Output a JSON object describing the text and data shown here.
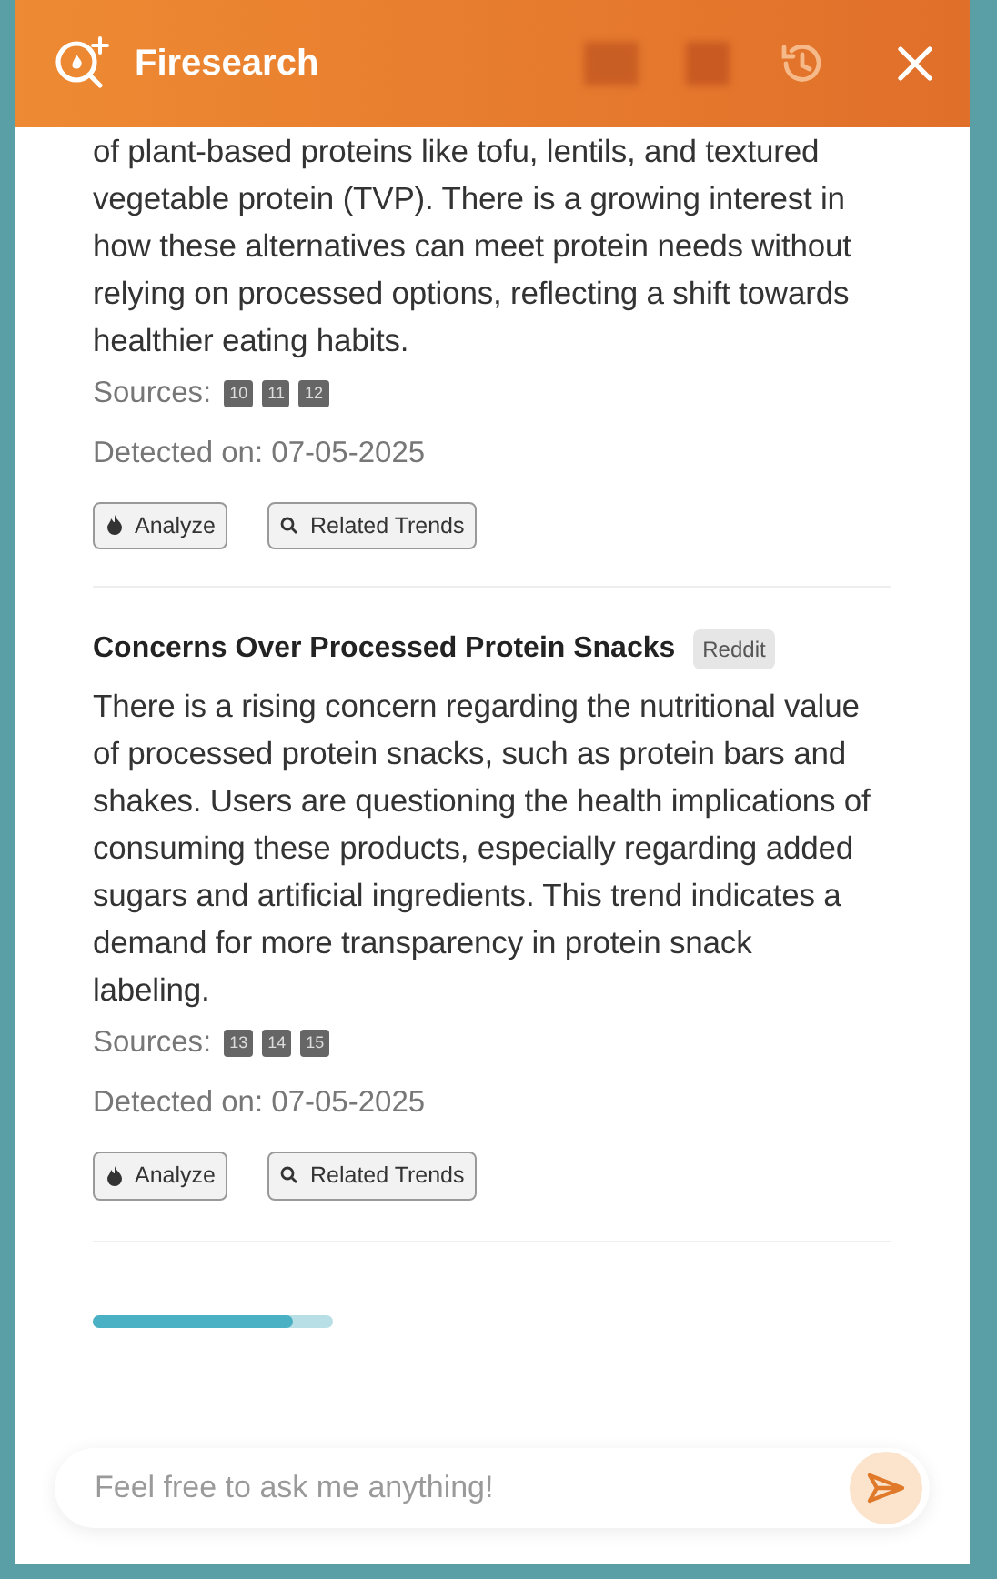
{
  "header": {
    "title": "Firesearch"
  },
  "trends": [
    {
      "description": "of plant-based proteins like tofu, lentils, and textured vegetable protein (TVP). There is a growing interest in how these alternatives can meet protein needs without relying on processed options, reflecting a shift towards healthier eating habits.",
      "sources_label": "Sources:",
      "sources": [
        "10",
        "11",
        "12"
      ],
      "detected": "Detected on: 07-05-2025",
      "actions": [
        "Analyze",
        "Related Trends"
      ]
    },
    {
      "title": "Concerns Over Processed Protein Snacks",
      "source": "Reddit",
      "description": "There is a rising concern regarding the nutritional value of processed protein snacks, such as protein bars and shakes. Users are questioning the health implications of consuming these products, especially regarding added sugars and artificial ingredients. This trend indicates a demand for more transparency in protein snack labeling.",
      "sources_label": "Sources:",
      "sources": [
        "13",
        "14",
        "15"
      ],
      "detected": "Detected on: 07-05-2025",
      "actions": [
        "Analyze",
        "Related Trends"
      ]
    }
  ],
  "progress": {
    "level": 0.83
  },
  "chat": {
    "placeholder": "Feel free to ask me anything!"
  }
}
